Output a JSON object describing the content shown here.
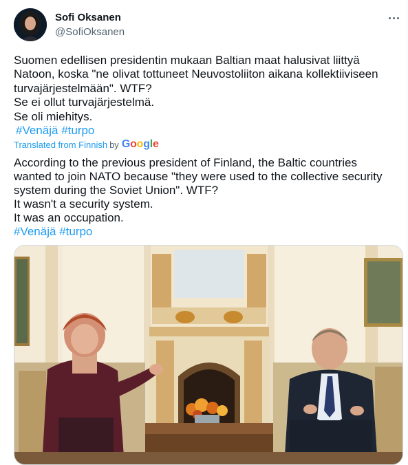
{
  "author": {
    "name": "Sofi Oksanen",
    "handle": "@SofiOksanen",
    "avatar_icon": "profile-photo"
  },
  "more_icon": "more-horizontal-icon",
  "original": {
    "lines": [
      "Suomen edellisen presidentin mukaan Baltian maat halusivat liittyä",
      "Natoon, koska \"ne olivat tottuneet Neuvostoliiton aikana kollektiiviseen",
      "turvajärjestelmään\". WTF?",
      "Se ei ollut turvajärjestelmä.",
      "Se oli miehitys."
    ],
    "hashtags": [
      "#Venäjä",
      "#turpo"
    ]
  },
  "translated_label": {
    "from": "Translated from Finnish",
    "by": "by",
    "brand": "Google"
  },
  "translation": {
    "lines": [
      "According to the previous president of Finland, the Baltic countries",
      "wanted to join NATO because \"they were used to the collective security",
      "system during the Soviet Union\". WTF?",
      "It wasn't a security system.",
      "It was an occupation."
    ],
    "hashtags": [
      "#Venäjä",
      "#turpo"
    ]
  },
  "media": {
    "type": "photo",
    "icon": "tweet-photo"
  },
  "colors": {
    "link": "#1d9bf0",
    "secondary": "#536471",
    "text": "#0f1419",
    "border": "#cfd9de"
  }
}
